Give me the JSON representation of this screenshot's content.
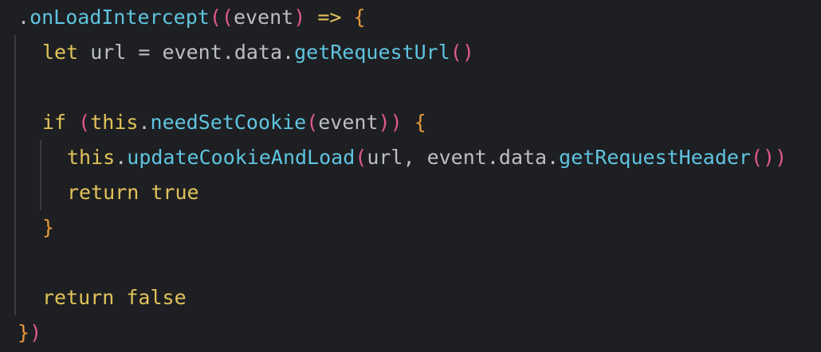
{
  "colors": {
    "background": "#1e1f22",
    "plain": "#bcbec4",
    "keyword": "#e1c35a",
    "method": "#5fc4e0",
    "paren_pink": "#e05a8c",
    "bracket_orange": "#e89a3c",
    "indent_guide": "#3a3c40"
  },
  "code": {
    "lines": [
      {
        "indent": 0,
        "tokens": [
          {
            "text": ".",
            "kind": "plain"
          },
          {
            "text": "onLoadIntercept",
            "kind": "method"
          },
          {
            "text": "((",
            "kind": "paren_pink"
          },
          {
            "text": "event",
            "kind": "plain"
          },
          {
            "text": ")",
            "kind": "paren_pink"
          },
          {
            "text": " => ",
            "kind": "keyword"
          },
          {
            "text": "{",
            "kind": "bracket_orange"
          }
        ]
      },
      {
        "indent": 1,
        "tokens": [
          {
            "text": "let",
            "kind": "keyword"
          },
          {
            "text": " url = event.data.",
            "kind": "plain"
          },
          {
            "text": "getRequestUrl",
            "kind": "method"
          },
          {
            "text": "()",
            "kind": "paren_pink"
          }
        ]
      },
      {
        "indent": 1,
        "tokens": []
      },
      {
        "indent": 1,
        "tokens": [
          {
            "text": "if",
            "kind": "keyword"
          },
          {
            "text": " ",
            "kind": "plain"
          },
          {
            "text": "(",
            "kind": "paren_pink"
          },
          {
            "text": "this",
            "kind": "keyword"
          },
          {
            "text": ".",
            "kind": "plain"
          },
          {
            "text": "needSetCookie",
            "kind": "method"
          },
          {
            "text": "(",
            "kind": "paren_pink"
          },
          {
            "text": "event",
            "kind": "plain"
          },
          {
            "text": "))",
            "kind": "paren_pink"
          },
          {
            "text": " ",
            "kind": "plain"
          },
          {
            "text": "{",
            "kind": "bracket_orange"
          }
        ]
      },
      {
        "indent": 2,
        "tokens": [
          {
            "text": "this",
            "kind": "keyword"
          },
          {
            "text": ".",
            "kind": "plain"
          },
          {
            "text": "updateCookieAndLoad",
            "kind": "method"
          },
          {
            "text": "(",
            "kind": "paren_pink"
          },
          {
            "text": "url, event.data.",
            "kind": "plain"
          },
          {
            "text": "getRequestHeader",
            "kind": "method"
          },
          {
            "text": "())",
            "kind": "paren_pink"
          }
        ]
      },
      {
        "indent": 2,
        "tokens": [
          {
            "text": "return",
            "kind": "keyword"
          },
          {
            "text": " ",
            "kind": "plain"
          },
          {
            "text": "true",
            "kind": "keyword"
          }
        ]
      },
      {
        "indent": 1,
        "tokens": [
          {
            "text": "}",
            "kind": "bracket_orange"
          }
        ]
      },
      {
        "indent": 1,
        "tokens": []
      },
      {
        "indent": 1,
        "tokens": [
          {
            "text": "return",
            "kind": "keyword"
          },
          {
            "text": " ",
            "kind": "plain"
          },
          {
            "text": "false",
            "kind": "keyword"
          }
        ]
      },
      {
        "indent": 0,
        "tokens": [
          {
            "text": "}",
            "kind": "bracket_orange"
          },
          {
            "text": ")",
            "kind": "paren_pink"
          }
        ]
      }
    ]
  }
}
